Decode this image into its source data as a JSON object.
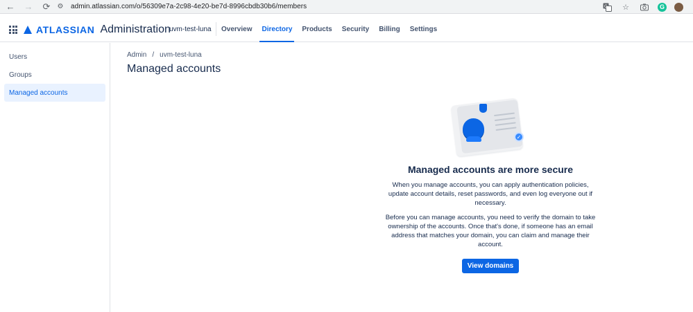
{
  "browser": {
    "url": "admin.atlassian.com/o/56309e7a-2c98-4e20-be7d-8996cbdb30b6/members",
    "back_icon": "←",
    "forward_icon": "→",
    "reload_icon": "⟳",
    "site_info_icon": "⚙"
  },
  "header": {
    "logo_text": "ATLASSIAN",
    "product": "Administration",
    "org_name": "uvm-test-luna",
    "tabs": [
      {
        "label": "Overview"
      },
      {
        "label": "Directory"
      },
      {
        "label": "Products"
      },
      {
        "label": "Security"
      },
      {
        "label": "Billing"
      },
      {
        "label": "Settings"
      }
    ],
    "active_tab": "Directory"
  },
  "sidebar": {
    "items": [
      {
        "label": "Users"
      },
      {
        "label": "Groups"
      },
      {
        "label": "Managed accounts"
      }
    ],
    "active_item": "Managed accounts"
  },
  "main": {
    "breadcrumb": [
      "Admin",
      "/",
      "uvm-test-luna"
    ],
    "title": "Managed accounts",
    "empty_state": {
      "heading": "Managed accounts are more secure",
      "para1": "When you manage accounts, you can apply authentication policies, update account details, reset passwords, and even log everyone out if necessary.",
      "para2": "Before you can manage accounts, you need to verify the domain to take ownership of the accounts. Once that's done, if someone has an email address that matches your domain, you can claim and manage their account.",
      "button": "View domains"
    }
  },
  "colors": {
    "brand": "#0c66e4",
    "selected_bg": "#e9f2ff",
    "text": "#172b4d"
  }
}
